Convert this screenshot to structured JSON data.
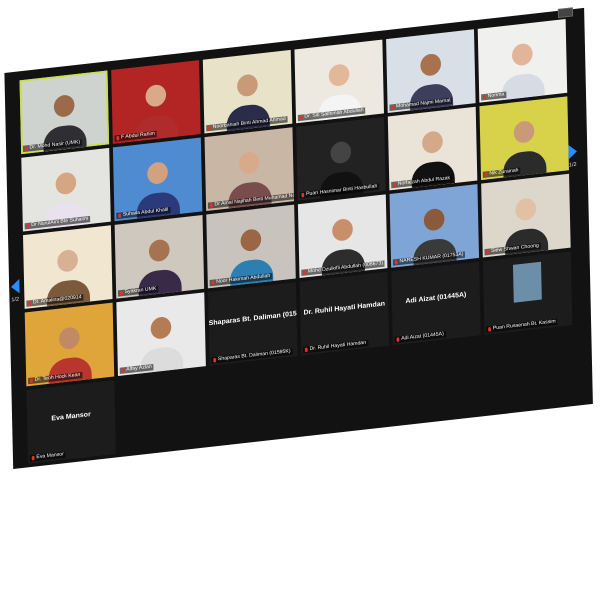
{
  "meeting": {
    "page_left": "1/2",
    "page_right": "1/2"
  },
  "participants": [
    {
      "name": "Dr. Mohd Nasir (UMK)",
      "video": true,
      "active": true,
      "skin": "#9b6a4a",
      "top": "#2f2f33",
      "bg": "#cfd3d0"
    },
    {
      "name": "F Abdul Rahim",
      "video": true,
      "skin": "#d9a98a",
      "top": "#b02b2b",
      "bg": "#b32424"
    },
    {
      "name": "Noorbahiah Binti Ahmad Ahmad",
      "video": true,
      "skin": "#c99a78",
      "top": "#2b2b4a",
      "bg": "#e7e2c8"
    },
    {
      "name": "Dr. Siti Salhimah Abdullah",
      "video": true,
      "skin": "#e3b79a",
      "top": "#f4f4f4",
      "bg": "#ede9e1"
    },
    {
      "name": "Mohamad Najmi Mamat",
      "video": true,
      "skin": "#a9724f",
      "top": "#3d3d5c",
      "bg": "#d9dfe6"
    },
    {
      "name": "Norima",
      "video": true,
      "skin": "#e2b49a",
      "top": "#d7dbe3",
      "bg": "#f0f0ee"
    },
    {
      "name": "Dr NurulAini Bte Suhaimi",
      "video": true,
      "skin": "#d6a683",
      "top": "#e9e1ee",
      "bg": "#e4e4e0"
    },
    {
      "name": "Suhaila Abdul Khalil",
      "video": true,
      "skin": "#d2a180",
      "top": "#2a3a7a",
      "bg": "#4f8bd1"
    },
    {
      "name": "Dr Amal Najihah Binti Muhamad Nor",
      "video": true,
      "skin": "#d8a98a",
      "top": "#7a4d4d",
      "bg": "#c9b7a6"
    },
    {
      "name": "Puan Hasnimar Binti Hasbullah",
      "video": true,
      "skin": "#444",
      "top": "#111",
      "bg": "#222222"
    },
    {
      "name": "Norfaizah Abdul Razak",
      "video": true,
      "skin": "#d6a88a",
      "top": "#111",
      "bg": "#e9e3d8"
    },
    {
      "name": "Nik Zurainah",
      "video": true,
      "skin": "#c99a7a",
      "top": "#2b2b2b",
      "bg": "#d8d24a"
    },
    {
      "name": "Dr. Amalina@020914",
      "video": true,
      "skin": "#d8b093",
      "top": "#7a5a3a",
      "bg": "#f1e6d0"
    },
    {
      "name": "Syakran UMK",
      "video": true,
      "skin": "#a67350",
      "top": "#3a2a4a",
      "bg": "#cfc8be"
    },
    {
      "name": "Noor Hakimah Abdullah",
      "video": true,
      "skin": "#9b6546",
      "top": "#2d7fb3",
      "bg": "#c8c4bd"
    },
    {
      "name": "Mohd Dzulkifli Abdullah (006673)",
      "video": true,
      "skin": "#c98f6a",
      "top": "#2d2d2d",
      "bg": "#e6e6e6"
    },
    {
      "name": "NARESH KUMAR (01753A)",
      "video": true,
      "skin": "#8a5a3d",
      "top": "#3a3a3a",
      "bg": "#7fa4d6"
    },
    {
      "name": "Siew Shwan Choong",
      "video": true,
      "skin": "#e2c0a3",
      "top": "#2b2b2b",
      "bg": "#dcd6cb"
    },
    {
      "name": "Dr. Teoh Hock Kean",
      "video": true,
      "skin": "#c18a65",
      "top": "#b9362f",
      "bg": "#e0a53a"
    },
    {
      "name": "Alfay Azlan",
      "video": true,
      "skin": "#b47c55",
      "top": "#dcdcdc",
      "bg": "#e9e9e9"
    },
    {
      "name": "Shaparas Bt. Daliman (015...",
      "label": "Shaparas Bt. Daliman (01595K)",
      "video": false
    },
    {
      "name": "Dr. Ruhil Hayati Hamdan",
      "label": "Dr. Ruhil Hayati Hamdan",
      "video": false
    },
    {
      "name": "Adi Aizat (01445A)",
      "label": "Adi Aizat (01445A)",
      "video": false
    },
    {
      "name": "Puan Rusaenah Bt. Kassim",
      "label": "Puan Rusaenah Bt. Kassim",
      "video": false,
      "avatar": true
    },
    {
      "name": "Eva Mansor",
      "label": "Eva Mansor",
      "video": false
    }
  ]
}
